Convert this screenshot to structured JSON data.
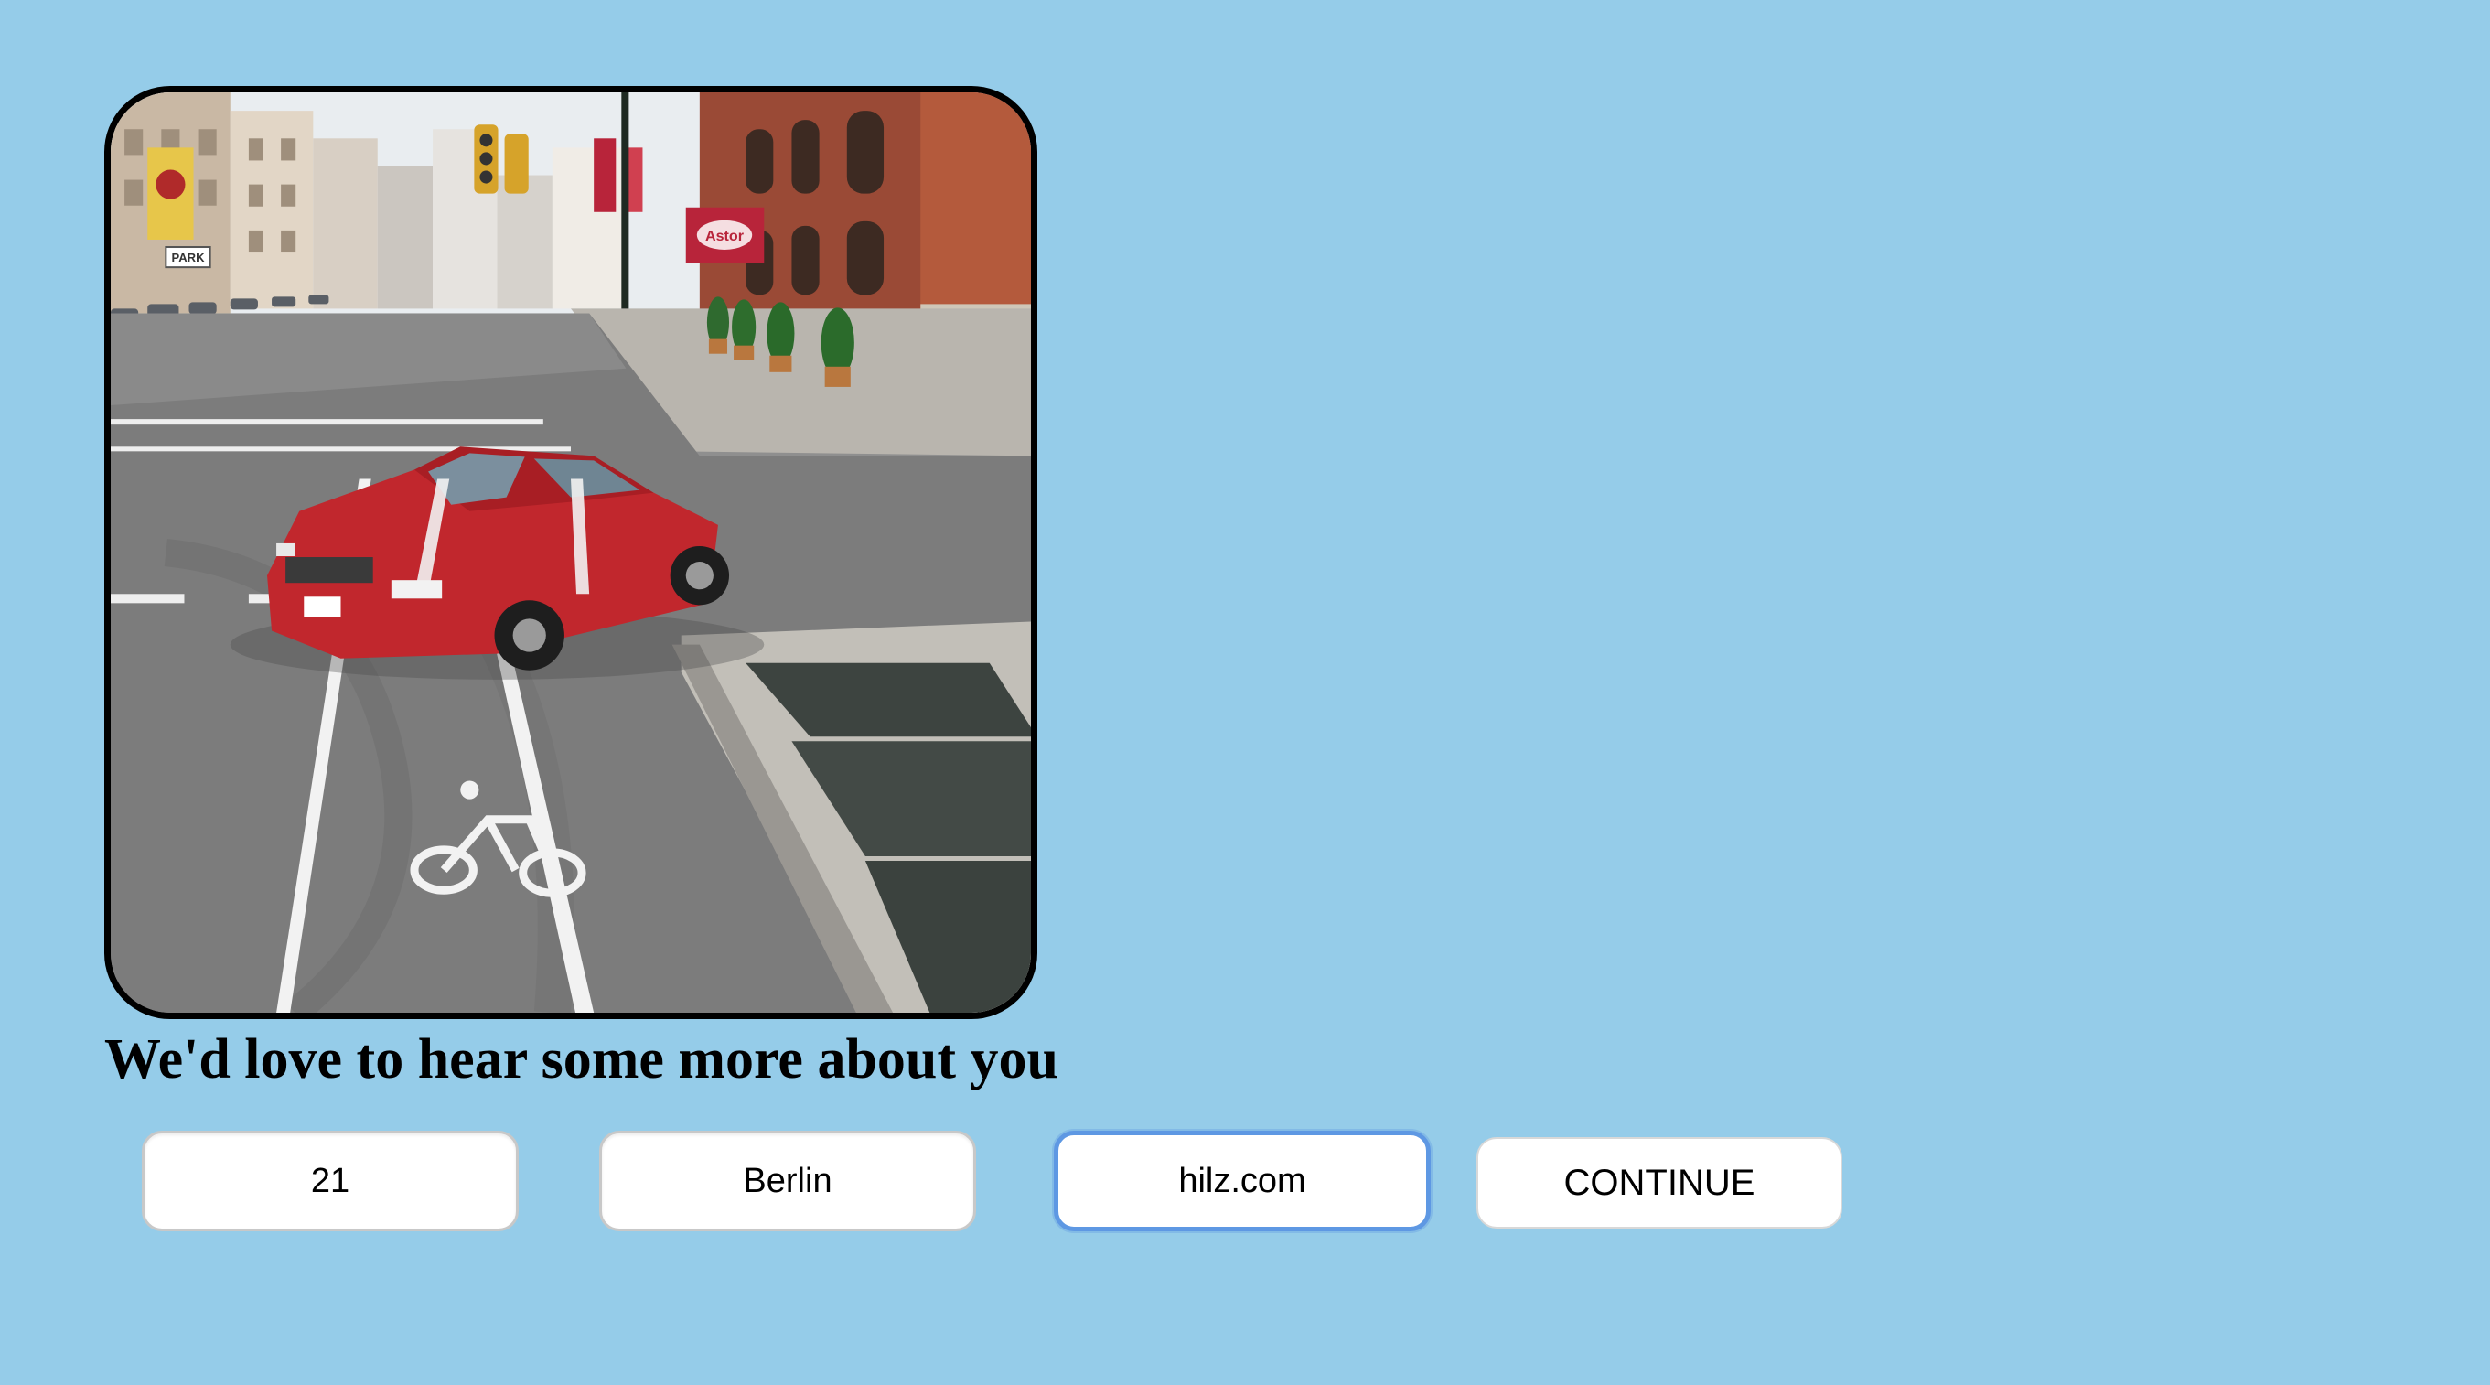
{
  "photo": {
    "sign_text": "Astor",
    "parking_sign": "PARK"
  },
  "heading": "We'd love to hear some more about you",
  "form": {
    "age_value": "21",
    "city_value": "Berlin",
    "website_value": "hilz.com",
    "continue_label": "CONTINUE"
  },
  "colors": {
    "background": "#95cce9",
    "focus_ring": "#5e98e3",
    "car": "#c1272d"
  }
}
